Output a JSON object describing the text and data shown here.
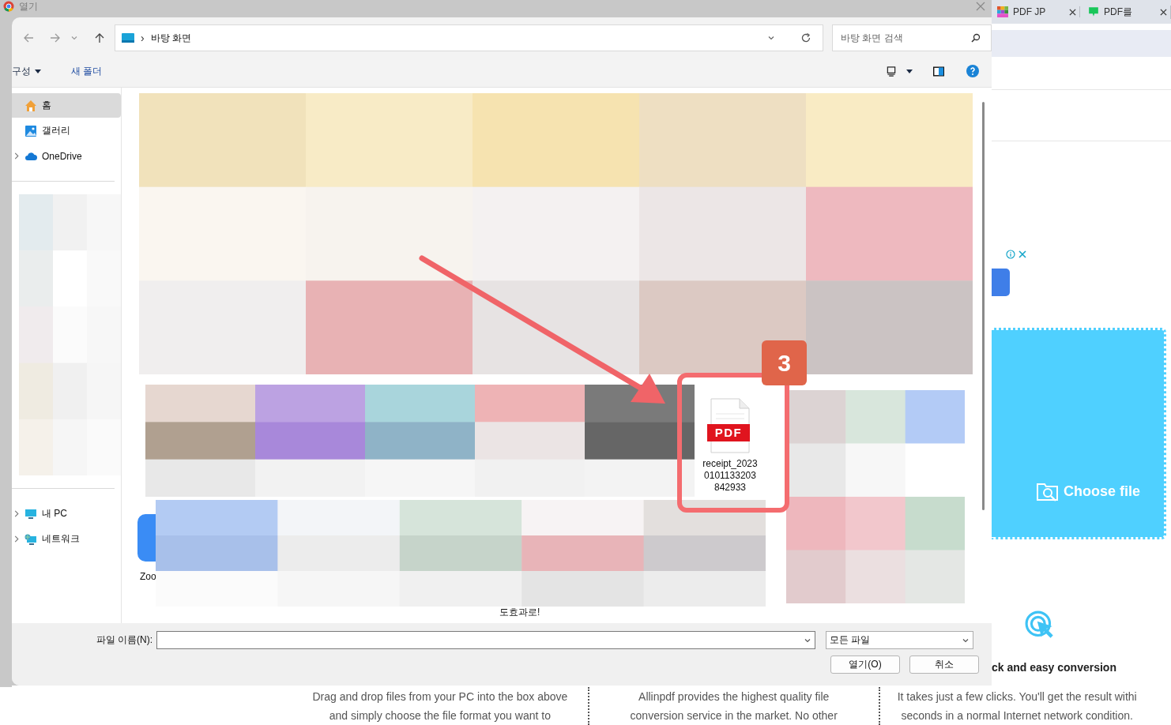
{
  "window": {
    "title": "열기"
  },
  "browser_tabs": [
    {
      "label": "PDF JP",
      "selected": false
    },
    {
      "label": "PDF를",
      "selected": false
    }
  ],
  "nav": {
    "separator": "›",
    "path": "바탕 화면",
    "search": {
      "placeholder": "바탕 화면 검색"
    }
  },
  "toolbar": {
    "organize": "구성",
    "new_folder": "새 폴더"
  },
  "sidebar": {
    "top": [
      {
        "label": "홈",
        "selected": true,
        "expandable": false,
        "kind": "home"
      },
      {
        "label": "갤러리",
        "selected": false,
        "expandable": false,
        "kind": "gallery"
      },
      {
        "label": "OneDrive",
        "selected": false,
        "expandable": true,
        "kind": "cloud"
      }
    ],
    "bottom": [
      {
        "label": "내 PC",
        "selected": false,
        "expandable": true,
        "kind": "pc"
      },
      {
        "label": "네트워크",
        "selected": false,
        "expandable": true,
        "kind": "network"
      }
    ]
  },
  "files": {
    "highlighted": {
      "name": "receipt_2023\n0101133203\n842933",
      "icon_label": "PDF"
    },
    "labels": [
      {
        "text": "Zoo"
      },
      {
        "text": "도효과로!"
      }
    ]
  },
  "annotation": {
    "badge": "3"
  },
  "footer": {
    "filename_label": "파일 이름(N):",
    "filter": "모든 파일",
    "open_button": "열기(O)",
    "cancel_button": "취소"
  },
  "page": {
    "choose_file": "Choose file",
    "feature_title": "ck and easy conversion",
    "columns": [
      "Drag and drop files from your PC into the box above\nand simply choose the file format you want to",
      "Allinpdf provides the highest quality file\nconversion service in the market. No other",
      "It takes just a few clicks. You'll get the result withi\nseconds in a normal Internet network condition."
    ]
  }
}
